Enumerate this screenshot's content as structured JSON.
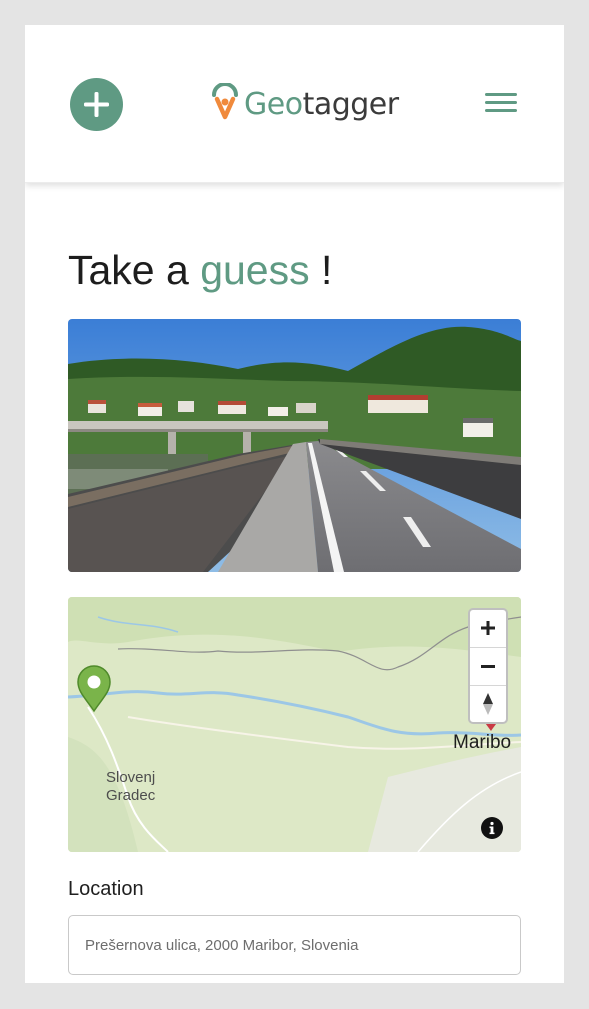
{
  "header": {
    "logo_geo": "Geo",
    "logo_tagger": "tagger"
  },
  "page": {
    "headline_start": "Take a ",
    "headline_accent": "guess",
    "headline_end": " !"
  },
  "map": {
    "labels": {
      "slovenj_line1": "Slovenj",
      "slovenj_line2": "Gradec",
      "maribor": "Maribo"
    },
    "zoom_in_icon": "plus-icon",
    "zoom_out_icon": "minus-icon",
    "compass_icon": "compass-north-icon",
    "info_icon": "info-icon",
    "guess_pin_color": "#7ab44a",
    "target_pin_color": "#c93a45"
  },
  "location": {
    "label": "Location",
    "placeholder": "Prešernova ulica, 2000 Maribor, Slovenia"
  },
  "colors": {
    "accent": "#5f9a83",
    "background": "#e4e4e4"
  }
}
